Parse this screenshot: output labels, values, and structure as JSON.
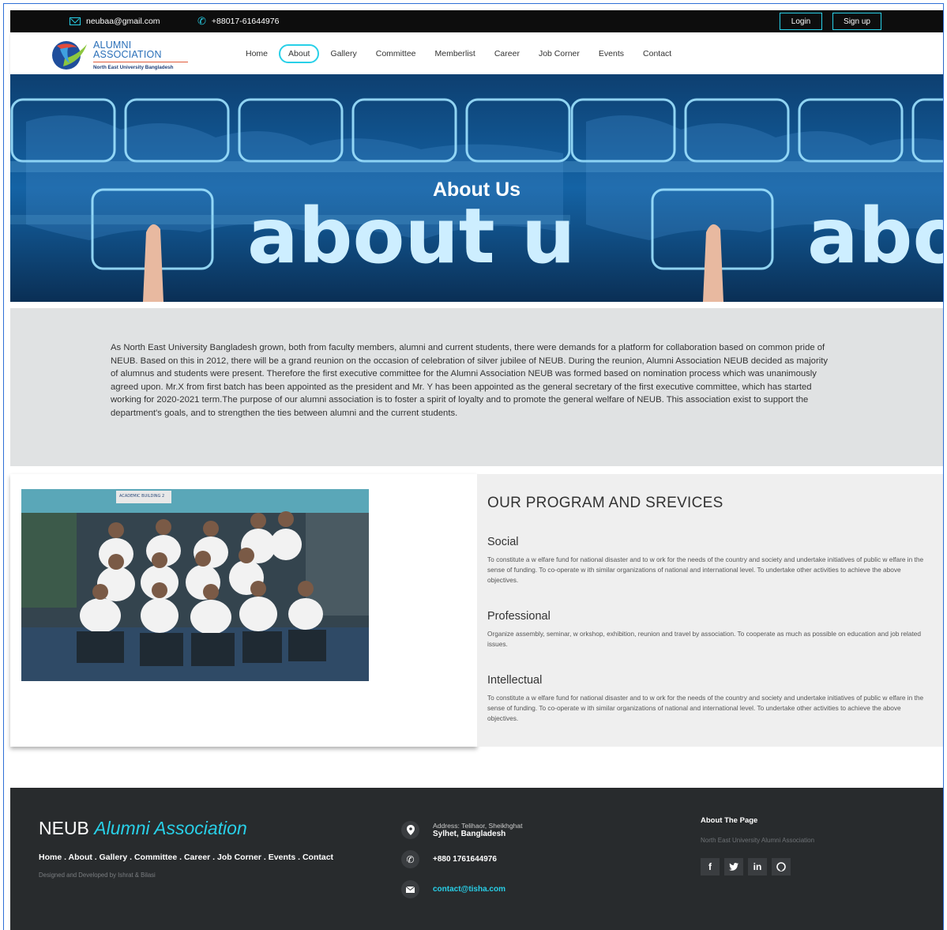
{
  "topbar": {
    "email": "neubaa@gmail.com",
    "phone": "+88017-61644976",
    "login": "Login",
    "signup": "Sign up"
  },
  "logo": {
    "line1": "ALUMNI",
    "line2": "ASSOCIATION",
    "subtitle": "North East University Bangladesh"
  },
  "nav": {
    "items": [
      "Home",
      "About",
      "Gallery",
      "Committee",
      "Memberlist",
      "Career",
      "Job Corner",
      "Events",
      "Contact"
    ],
    "active": "About"
  },
  "hero": {
    "title": "About Us",
    "graphic_text": "about us"
  },
  "about": {
    "text": "As North East University Bangladesh grown, both from faculty members, alumni and current students, there were demands for a platform for collaboration based on common pride of NEUB. Based on this in 2012, there will be a grand reunion on the occasion of celebration of silver jubilee of NEUB. During the reunion, Alumni Association NEUB decided as majority of alumnus and students were present. Therefore the first executive committee for the Alumni Association NEUB was formed based on nomination process which was unanimously agreed upon. Mr.X from first batch has been appointed as the president and Mr. Y has been appointed as the general secretary of the first executive committee, which has started working for 2020-2021 term.The purpose of our alumni association is to foster a spirit of loyalty and to promote the general welfare of NEUB. This association exist to support the department's goals, and to strengthen the ties between alumni and the current students."
  },
  "programs": {
    "photo_sign": "ACADEMIC BUILDING 2",
    "title": "OUR PROGRAM AND SREVICES",
    "items": [
      {
        "heading": "Social",
        "text": "To constitute a w elfare fund for national disaster and to w ork for the needs of the country and society and undertake initiatives of public w elfare in the sense of funding. To co-operate w ith similar organizations of national and international level. To undertake other activities to achieve the above objectives."
      },
      {
        "heading": "Professional",
        "text": "Organize assembly, seminar, w orkshop, exhibition, reunion and travel by association. To cooperate as much as possible on education and job related issues."
      },
      {
        "heading": "Intellectual",
        "text": "To constitute a w elfare fund for national disaster and to w ork for the needs of the country and society and undertake initiatives of public w elfare in the sense of funding. To co-operate w ith similar organizations of national and international level. To undertake other activities to achieve the above objectives."
      }
    ]
  },
  "footer": {
    "brand_plain": "NEUB",
    "brand_accent": "Alumni Association",
    "links": "Home . About . Gallery . Committee . Career . Job Corner . Events . Contact",
    "credit": "Designed and Developed by Ishrat & Bilasi",
    "address_label": "Address: Telihaor, Sheikhghat",
    "address_city": "Sylhet, Bangladesh",
    "phone": "+880 1761644976",
    "email": "contact@tisha.com",
    "about_heading": "About The Page",
    "about_text": "North East University Alumni Association",
    "socials": [
      "facebook",
      "twitter",
      "linkedin",
      "github"
    ]
  },
  "colors": {
    "accent": "#28d0e8",
    "topbar": "#0d0d0d",
    "footer": "#282b2d",
    "about_bg": "#e0e2e3"
  }
}
